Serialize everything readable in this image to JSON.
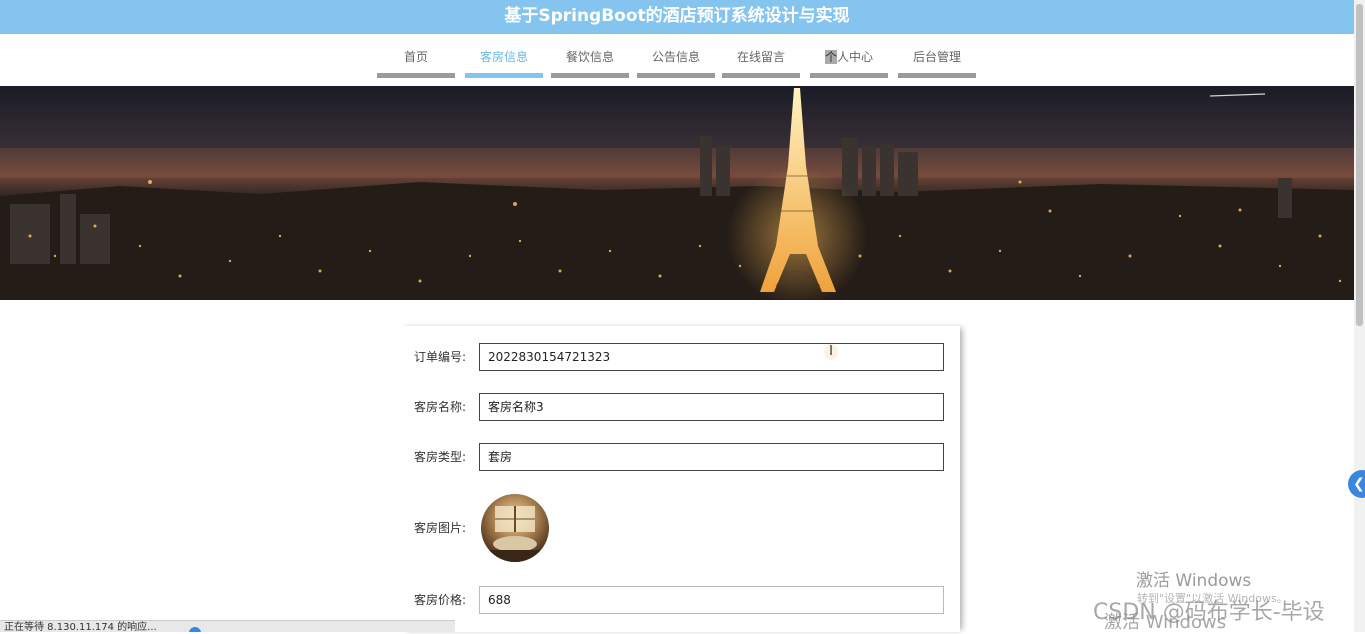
{
  "header": {
    "title": "基于SpringBoot的酒店预订系统设计与实现"
  },
  "nav": {
    "items": [
      {
        "label": "首页"
      },
      {
        "label": "客房信息"
      },
      {
        "label": "餐饮信息"
      },
      {
        "label": "公告信息"
      },
      {
        "label": "在线留言"
      },
      {
        "label_prefix": "个",
        "label_rest": "人中心"
      },
      {
        "label": "后台管理"
      }
    ],
    "active_index": 1
  },
  "form": {
    "order_no": {
      "label": "订单编号:",
      "value": "2022830154721323"
    },
    "room_name": {
      "label": "客房名称:",
      "value": "客房名称3"
    },
    "room_type": {
      "label": "客房类型:",
      "value": "套房"
    },
    "room_image": {
      "label": "客房图片:"
    },
    "room_price": {
      "label": "客房价格:",
      "value": "688"
    }
  },
  "cursor": {
    "glyph": "I"
  },
  "float_button": {
    "glyph": "❮"
  },
  "status_bar": {
    "text": "正在等待 8.130.11.174 的响应..."
  },
  "watermarks": {
    "activate_title": "激活 Windows",
    "activate_sub": "转到\"设置\"以激活 Windows。",
    "csdn": "CSDN @码布学长-毕设",
    "activate_title_2": "激活 Windows"
  },
  "colors": {
    "header_bg": "#84c4ee",
    "nav_active": "#84c4ee",
    "nav_bar": "#9b9b9b"
  }
}
